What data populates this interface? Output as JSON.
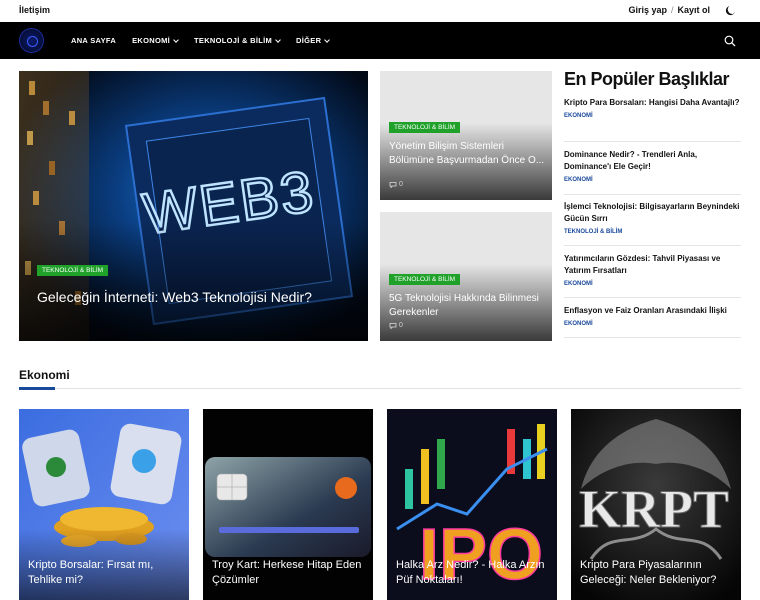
{
  "topbar": {
    "contact": "İletişim",
    "login": "Giriş yap",
    "separator": "/",
    "register": "Kayıt ol",
    "theme_icon": "moon-icon"
  },
  "nav": {
    "items": [
      {
        "label": "ANA SAYFA"
      },
      {
        "label": "EKONOMİ"
      },
      {
        "label": "TEKNOLOJİ & BİLİM"
      },
      {
        "label": "DİĞER"
      }
    ],
    "search_icon": "search-icon"
  },
  "hero": {
    "main": {
      "image_text": "WEB3",
      "badge": "TEKNOLOJİ & BİLİM",
      "title": "Geleceğin İnterneti: Web3 Teknolojisi Nedir?"
    },
    "side": [
      {
        "badge": "TEKNOLOJİ & BİLİM",
        "title": "Yönetim Bilişim Sistemleri Bölümüne Başvurmadan Önce O...",
        "comments": "0"
      },
      {
        "badge": "TEKNOLOJİ & BİLİM",
        "title": "5G Teknolojisi Hakkında Bilinmesi Gerekenler",
        "comments": "0"
      }
    ]
  },
  "popular": {
    "title": "En Popüler Başlıklar",
    "items": [
      {
        "title": "Kripto Para Borsaları: Hangisi Daha Avantajlı?",
        "category": "EKONOMİ"
      },
      {
        "title": "Dominance Nedir? - Trendleri Anla, Dominance'ı Ele Geçir!",
        "category": "EKONOMİ"
      },
      {
        "title": "İşlemci Teknolojisi: Bilgisayarların Beynindeki Gücün Sırrı",
        "category": "TEKNOLOJİ & BİLİM"
      },
      {
        "title": "Yatırımcıların Gözdesi: Tahvil Piyasası ve Yatırım Fırsatları",
        "category": "EKONOMİ"
      },
      {
        "title": "Enflasyon ve Faiz Oranları Arasındaki İlişki",
        "category": "EKONOMİ"
      }
    ]
  },
  "economy": {
    "title": "Ekonomi",
    "cards": [
      {
        "title": "Kripto Borsalar: Fırsat mı, Tehlike mi?"
      },
      {
        "title": "Troy Kart: Herkese Hitap Eden Çözümler"
      },
      {
        "title": "Halka Arz Nedir? - Halka Arzın Püf Noktaları!",
        "image_text": "IPO"
      },
      {
        "title": "Kripto Para Piyasalarının Geleceği: Neler Bekleniyor?",
        "image_text": "KRPT"
      }
    ]
  },
  "colors": {
    "accent": "#1a4a9c",
    "badge": "#1fa12a",
    "nav_bg": "#000000"
  }
}
